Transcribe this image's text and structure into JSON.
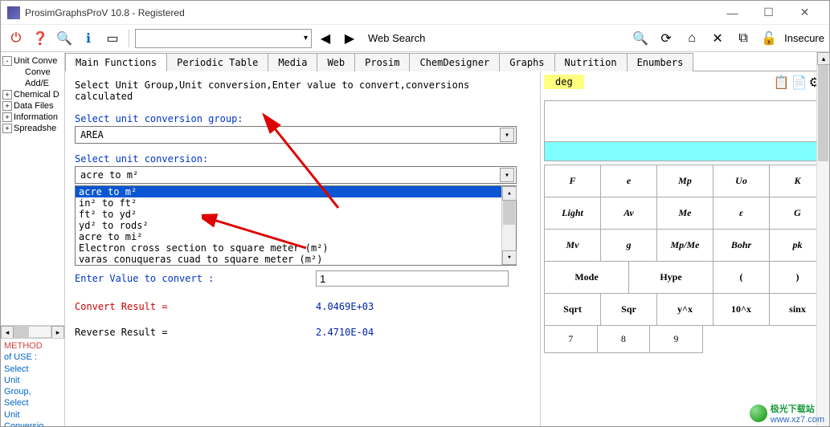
{
  "window": {
    "title": "ProsimGraphsProV 10.8 - Registered",
    "insecure": "Insecure"
  },
  "toolbar": {
    "web_search": "Web Search"
  },
  "sidebar": {
    "tree": [
      {
        "exp": "-",
        "label": "Unit Conve",
        "indent": 0
      },
      {
        "exp": "",
        "label": "Conve",
        "indent": 1
      },
      {
        "exp": "",
        "label": "Add/E",
        "indent": 1
      },
      {
        "exp": "+",
        "label": "Chemical D",
        "indent": 0
      },
      {
        "exp": "+",
        "label": "Data Files",
        "indent": 0
      },
      {
        "exp": "+",
        "label": "Information",
        "indent": 0
      },
      {
        "exp": "+",
        "label": "Spreadshe",
        "indent": 0
      }
    ],
    "method": [
      "METHOD",
      "of USE :",
      "Select",
      "Unit",
      "Group,",
      "Select",
      "Unit",
      "Conversio"
    ]
  },
  "tabs": [
    "Main Functions",
    "Periodic Table",
    "Media",
    "Web",
    "Prosim",
    "ChemDesigner",
    "Graphs",
    "Nutrition",
    "Enumbers"
  ],
  "panel": {
    "instruct": "Select Unit Group,Unit conversion,Enter value to convert,conversions calculated",
    "label_group": "Select unit conversion group:",
    "group_value": "AREA",
    "label_conv": "Select unit conversion:",
    "conv_value": "acre to  m²",
    "list": [
      "acre to  m²",
      "in² to ft²",
      "ft² to yd²",
      "yd² to rods²",
      "acre to mi²",
      "Electron cross section to square meter (m²)",
      "varas conuqueras cuad to square meter (m²)",
      "varas castellanas cuad to square meter (m²)"
    ],
    "label_enter": "Enter Value to convert :",
    "enter_value": "1",
    "convert_label": "Convert Result =",
    "convert_value": "4.0469E+03",
    "reverse_label": "Reverse Result =",
    "reverse_value": "2.4710E-04"
  },
  "calc": {
    "deg": "deg",
    "row1": [
      "F",
      "e",
      "Mp",
      "Uo",
      "K"
    ],
    "row2": [
      "Light",
      "Av",
      "Me",
      "ε",
      "G"
    ],
    "row3": [
      "Mv",
      "g",
      "Mp/Me",
      "Bohr",
      "pk"
    ],
    "row4": [
      "Mode",
      "Hype",
      "(",
      ")"
    ],
    "row5": [
      "Sqrt",
      "Sqr",
      "y^x",
      "10^x",
      "sinx"
    ],
    "row6": [
      "7",
      "8",
      "9"
    ]
  },
  "watermark": {
    "name": "极光下载站",
    "url": "www.xz7.com"
  }
}
